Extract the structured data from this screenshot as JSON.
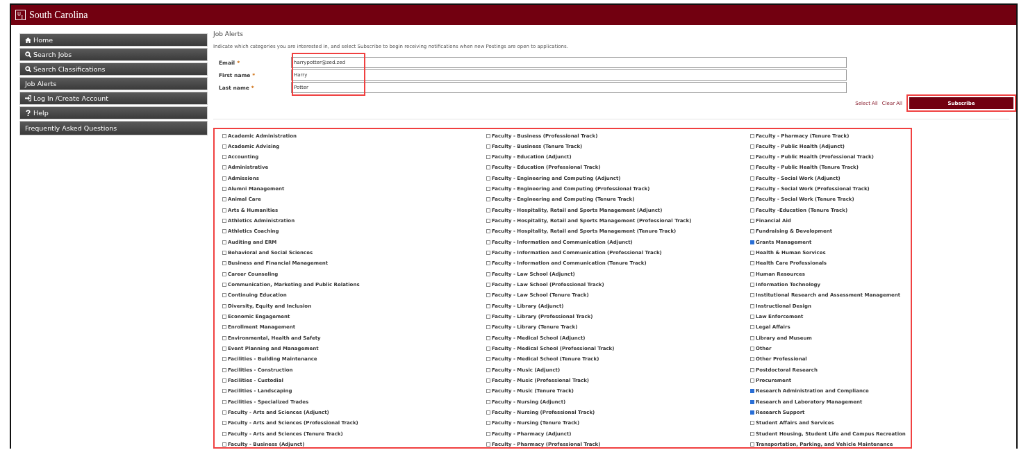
{
  "header": {
    "title": "South Carolina"
  },
  "sidebar": {
    "items": [
      {
        "label": "Home",
        "kind": "home"
      },
      {
        "label": "Search Jobs",
        "kind": "search"
      },
      {
        "label": "Search Classifications",
        "kind": "search"
      },
      {
        "label": "Job Alerts",
        "kind": "plain"
      },
      {
        "label": "Log In /Create Account",
        "kind": "login"
      },
      {
        "label": "Help",
        "kind": "help"
      },
      {
        "label": "Frequently Asked Questions",
        "kind": "plain"
      }
    ]
  },
  "page": {
    "title": "Job Alerts",
    "intro": "Indicate which categories you are interested in, and select Subscribe to begin receiving notifications when new Postings are open to applications."
  },
  "form": {
    "fields": [
      {
        "label": "Email",
        "required": "*",
        "value": "harrypotter@zed.zed"
      },
      {
        "label": "First name",
        "required": "*",
        "value": "Harry"
      },
      {
        "label": "Last name",
        "required": "*",
        "value": "Potter"
      }
    ],
    "links": [
      "Select All",
      "Clear All"
    ],
    "submit": "Subscribe"
  },
  "categories": [
    {
      "label": "Academic Administration",
      "checked": false
    },
    {
      "label": "Academic Advising",
      "checked": false
    },
    {
      "label": "Accounting",
      "checked": false
    },
    {
      "label": "Administrative",
      "checked": false
    },
    {
      "label": "Admissions",
      "checked": false
    },
    {
      "label": "Alumni Management",
      "checked": false
    },
    {
      "label": "Animal Care",
      "checked": false
    },
    {
      "label": "Arts & Humanities",
      "checked": false
    },
    {
      "label": "Athletics Administration",
      "checked": false
    },
    {
      "label": "Athletics Coaching",
      "checked": false
    },
    {
      "label": "Auditing and ERM",
      "checked": false
    },
    {
      "label": "Behavioral and Social Sciences",
      "checked": false
    },
    {
      "label": "Business and Financial Management",
      "checked": false
    },
    {
      "label": "Career Counseling",
      "checked": false
    },
    {
      "label": "Communication, Marketing and Public Relations",
      "checked": false
    },
    {
      "label": "Continuing Education",
      "checked": false
    },
    {
      "label": "Diversity, Equity and Inclusion",
      "checked": false
    },
    {
      "label": "Economic Engagement",
      "checked": false
    },
    {
      "label": "Enrollment Management",
      "checked": false
    },
    {
      "label": "Environmental, Health and Safety",
      "checked": false
    },
    {
      "label": "Event Planning and Management",
      "checked": false
    },
    {
      "label": "Facilities - Building Maintenance",
      "checked": false
    },
    {
      "label": "Facilities - Construction",
      "checked": false
    },
    {
      "label": "Facilities - Custodial",
      "checked": false
    },
    {
      "label": "Facilities - Landscaping",
      "checked": false
    },
    {
      "label": "Facilities - Specialized Trades",
      "checked": false
    },
    {
      "label": "Faculty - Arts and Sciences (Adjunct)",
      "checked": false
    },
    {
      "label": "Faculty - Arts and Sciences (Professional Track)",
      "checked": false
    },
    {
      "label": "Faculty - Arts and Sciences (Tenure Track)",
      "checked": false
    },
    {
      "label": "Faculty - Business (Adjunct)",
      "checked": false
    },
    {
      "label": "Faculty - Business (Professional Track)",
      "checked": false
    },
    {
      "label": "Faculty - Business (Tenure Track)",
      "checked": false
    },
    {
      "label": "Faculty - Education (Adjunct)",
      "checked": false
    },
    {
      "label": "Faculty - Education (Professional Track)",
      "checked": false
    },
    {
      "label": "Faculty - Engineering and Computing (Adjunct)",
      "checked": false
    },
    {
      "label": "Faculty - Engineering and Computing (Professional Track)",
      "checked": false
    },
    {
      "label": "Faculty - Engineering and Computing (Tenure Track)",
      "checked": false
    },
    {
      "label": "Faculty - Hospitality, Retail and Sports Management (Adjunct)",
      "checked": false
    },
    {
      "label": "Faculty - Hospitality, Retail and Sports Management (Professional Track)",
      "checked": false
    },
    {
      "label": "Faculty - Hospitality, Retail and Sports Management (Tenure Track)",
      "checked": false
    },
    {
      "label": "Faculty - Information and Communication (Adjunct)",
      "checked": false
    },
    {
      "label": "Faculty - Information and Communication (Professional Track)",
      "checked": false
    },
    {
      "label": "Faculty - Information and Communication (Tenure Track)",
      "checked": false
    },
    {
      "label": "Faculty - Law School (Adjunct)",
      "checked": false
    },
    {
      "label": "Faculty - Law School (Professional Track)",
      "checked": false
    },
    {
      "label": "Faculty - Law School (Tenure Track)",
      "checked": false
    },
    {
      "label": "Faculty - Library (Adjunct)",
      "checked": false
    },
    {
      "label": "Faculty - Library (Professional Track)",
      "checked": false
    },
    {
      "label": "Faculty - Library (Tenure Track)",
      "checked": false
    },
    {
      "label": "Faculty - Medical School (Adjunct)",
      "checked": false
    },
    {
      "label": "Faculty - Medical School (Professional Track)",
      "checked": false
    },
    {
      "label": "Faculty - Medical School (Tenure Track)",
      "checked": false
    },
    {
      "label": "Faculty - Music (Adjunct)",
      "checked": false
    },
    {
      "label": "Faculty - Music (Professional Track)",
      "checked": false
    },
    {
      "label": "Faculty - Music (Tenure Track)",
      "checked": false
    },
    {
      "label": "Faculty - Nursing (Adjunct)",
      "checked": false
    },
    {
      "label": "Faculty - Nursing (Professional Track)",
      "checked": false
    },
    {
      "label": "Faculty - Nursing (Tenure Track)",
      "checked": false
    },
    {
      "label": "Faculty - Pharmacy (Adjunct)",
      "checked": false
    },
    {
      "label": "Faculty - Pharmacy (Professional Track)",
      "checked": false
    },
    {
      "label": "Faculty - Pharmacy (Tenure Track)",
      "checked": false
    },
    {
      "label": "Faculty - Public Health (Adjunct)",
      "checked": false
    },
    {
      "label": "Faculty - Public Health (Professional Track)",
      "checked": false
    },
    {
      "label": "Faculty - Public Health (Tenure Track)",
      "checked": false
    },
    {
      "label": "Faculty - Social Work (Adjunct)",
      "checked": false
    },
    {
      "label": "Faculty - Social Work (Professional Track)",
      "checked": false
    },
    {
      "label": "Faculty - Social Work (Tenure Track)",
      "checked": false
    },
    {
      "label": "Faculty -Education (Tenure Track)",
      "checked": false
    },
    {
      "label": "Financial Aid",
      "checked": false
    },
    {
      "label": "Fundraising & Development",
      "checked": false
    },
    {
      "label": "Grants Management",
      "checked": true
    },
    {
      "label": "Health & Human Services",
      "checked": false
    },
    {
      "label": "Health Care Professionals",
      "checked": false
    },
    {
      "label": "Human Resources",
      "checked": false
    },
    {
      "label": "Information Technology",
      "checked": false
    },
    {
      "label": "Institutional Research and Assessment Management",
      "checked": false
    },
    {
      "label": "Instructional Design",
      "checked": false
    },
    {
      "label": "Law Enforcement",
      "checked": false
    },
    {
      "label": "Legal Affairs",
      "checked": false
    },
    {
      "label": "Library and Museum",
      "checked": false
    },
    {
      "label": "Other",
      "checked": false
    },
    {
      "label": "Other Professional",
      "checked": false
    },
    {
      "label": "Postdoctoral Research",
      "checked": false
    },
    {
      "label": "Procurement",
      "checked": false
    },
    {
      "label": "Research Administration and Compliance",
      "checked": true
    },
    {
      "label": "Research and Laboratory Management",
      "checked": true
    },
    {
      "label": "Research Support",
      "checked": true
    },
    {
      "label": "Student Affairs and Services",
      "checked": false
    },
    {
      "label": "Student Housing, Student Life and Campus Recreation",
      "checked": false
    },
    {
      "label": "Transportation, Parking, and Vehicle Maintenance",
      "checked": false
    }
  ]
}
